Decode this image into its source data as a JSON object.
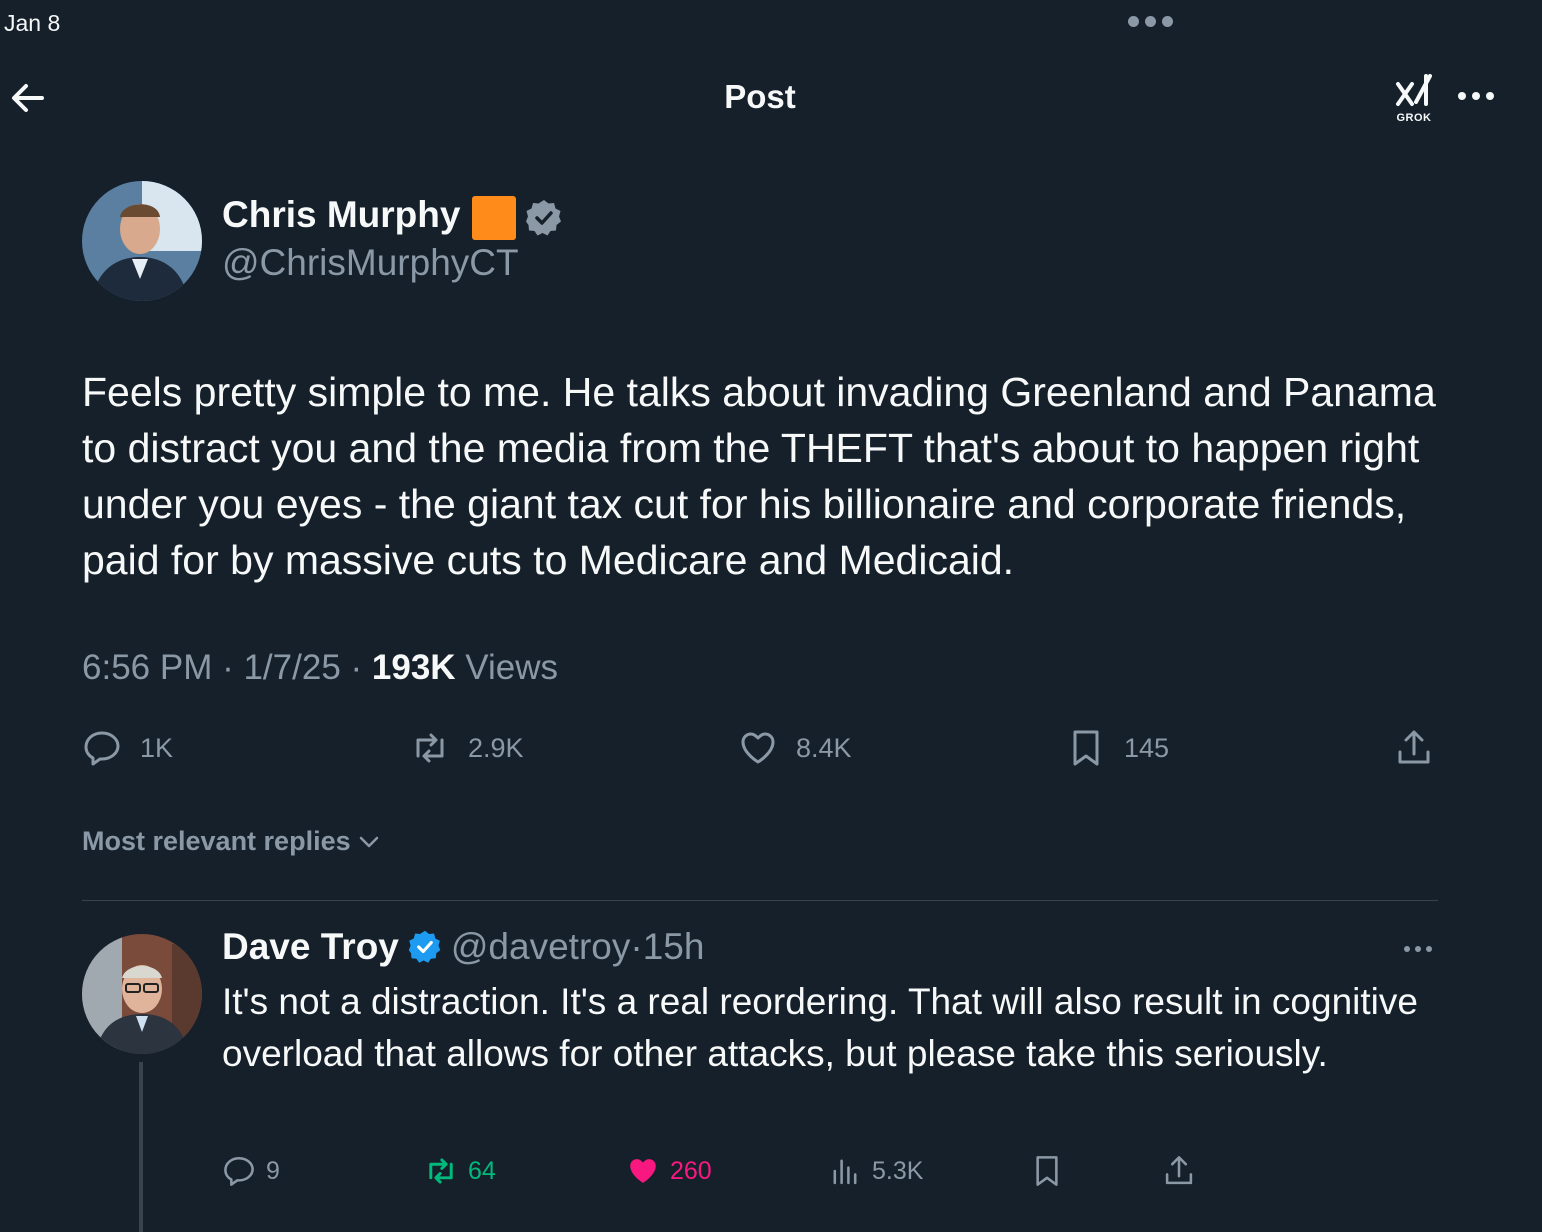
{
  "status_bar": {
    "date": "Jan 8"
  },
  "header": {
    "title": "Post",
    "grok_label": "GROK"
  },
  "post": {
    "author": {
      "name": "Chris Murphy",
      "handle": "@ChrisMurphyCT",
      "flag_color": "#ff8c1a"
    },
    "text": "Feels pretty simple to me. He talks about invading Greenland and Panama to distract you and the media from the THEFT that's about to happen right under you eyes - the giant tax cut for his billionaire and corporate friends, paid for by massive cuts to Medicare and Medicaid.",
    "time": "6:56 PM",
    "date": "1/7/25",
    "views_count": "193K",
    "views_label": "Views",
    "actions": {
      "replies": "1K",
      "reposts": "2.9K",
      "likes": "8.4K",
      "bookmarks": "145"
    }
  },
  "replies_sort": {
    "label": "Most relevant replies"
  },
  "reply": {
    "name": "Dave Troy",
    "handle": "@davetroy",
    "time": "15h",
    "text": "It's not a distraction. It's a real reordering. That will also result in cognitive overload that allows for other attacks, but please take this seriously.",
    "actions": {
      "replies": "9",
      "reposts": "64",
      "likes": "260",
      "views": "5.3K"
    }
  },
  "colors": {
    "background": "#15202b",
    "muted": "#8b98a5",
    "accent_blue": "#1d9bf0",
    "repost_green": "#00ba7c",
    "like_pink": "#f91880"
  }
}
